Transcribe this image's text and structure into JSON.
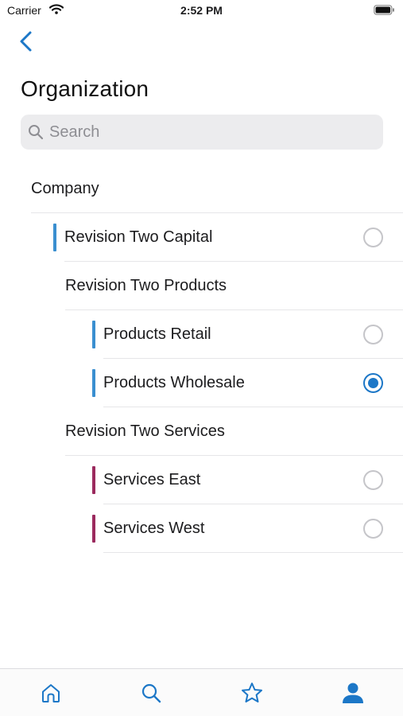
{
  "status_bar": {
    "carrier": "Carrier",
    "time": "2:52 PM"
  },
  "nav": {
    "back_icon": "chevron-left-icon"
  },
  "page": {
    "title": "Organization"
  },
  "search": {
    "placeholder": "Search",
    "value": ""
  },
  "tree": [
    {
      "label": "Company",
      "selectable": false,
      "level_color": null,
      "selected": false
    },
    {
      "label": "Revision Two Capital",
      "selectable": true,
      "level_color": "#3a8fd0",
      "selected": false
    },
    {
      "label": "Revision Two Products",
      "selectable": false,
      "level_color": null,
      "selected": false
    },
    {
      "label": "Products Retail",
      "selectable": true,
      "level_color": "#3a8fd0",
      "selected": false
    },
    {
      "label": "Products Wholesale",
      "selectable": true,
      "level_color": "#3a8fd0",
      "selected": true
    },
    {
      "label": "Revision Two Services",
      "selectable": false,
      "level_color": null,
      "selected": false
    },
    {
      "label": "Services East",
      "selectable": true,
      "level_color": "#9b2a5e",
      "selected": false
    },
    {
      "label": "Services West",
      "selectable": true,
      "level_color": "#9b2a5e",
      "selected": false
    }
  ],
  "tab_bar": {
    "items": [
      {
        "icon": "home-icon"
      },
      {
        "icon": "search-icon"
      },
      {
        "icon": "star-icon"
      },
      {
        "icon": "person-icon",
        "active": true
      }
    ]
  },
  "colors": {
    "accent": "#1c77c7",
    "capital_products_bar": "#3a8fd0",
    "services_bar": "#9b2a5e"
  }
}
